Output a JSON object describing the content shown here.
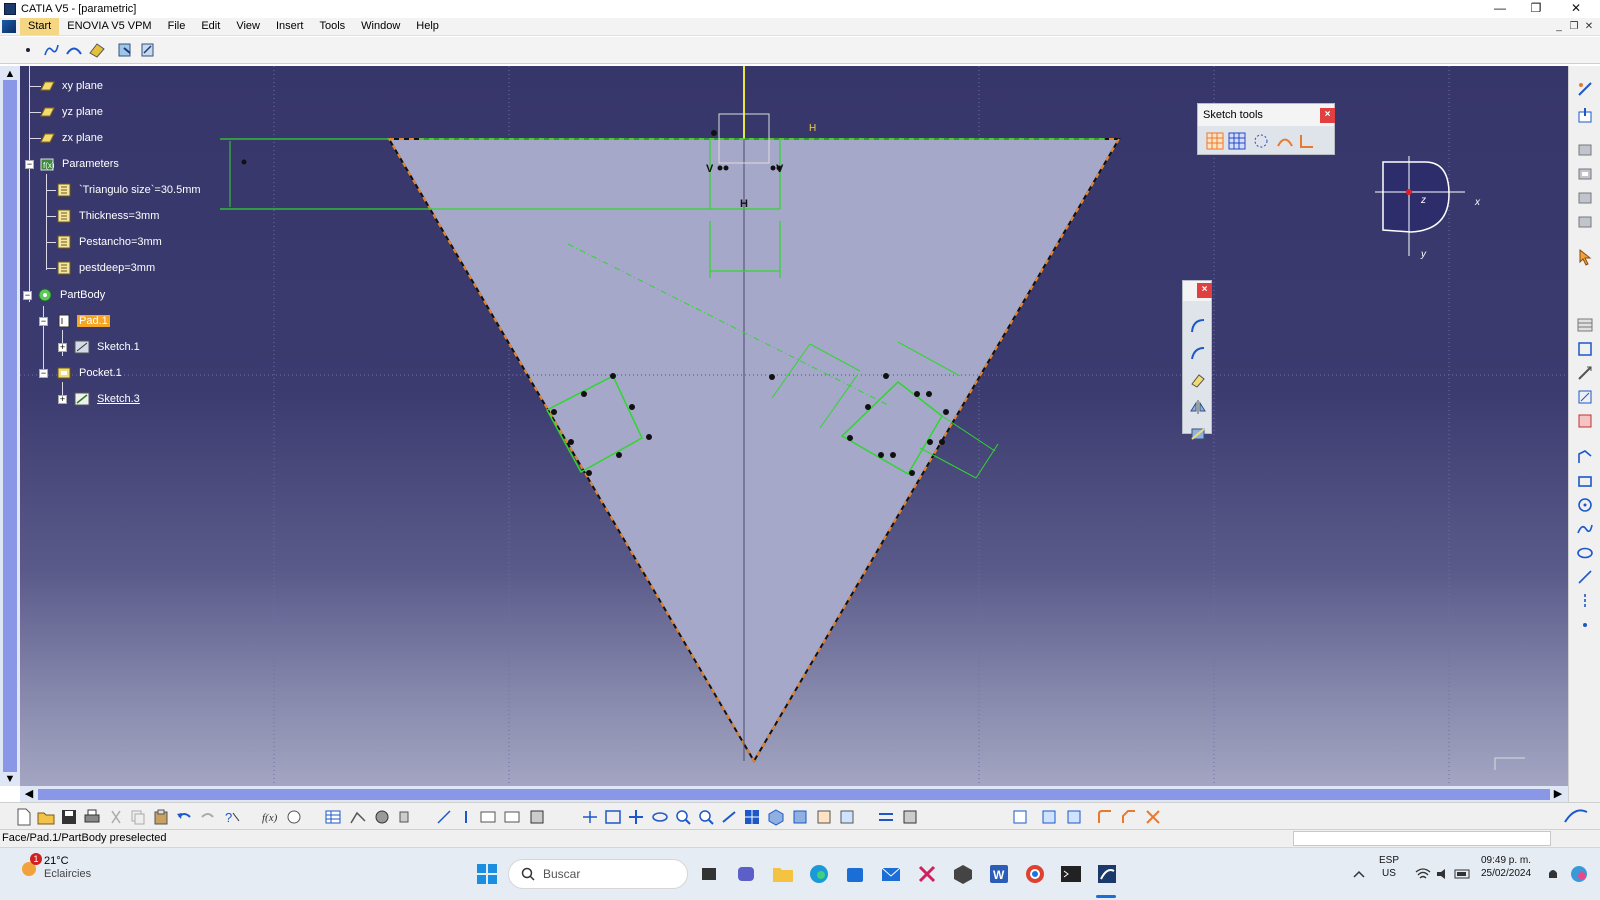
{
  "window": {
    "title": "CATIA V5 - [parametric]",
    "minimize": "—",
    "maximize": "❐",
    "close": "✕"
  },
  "menu": {
    "items": [
      "Start",
      "ENOVIA V5 VPM",
      "File",
      "Edit",
      "View",
      "Insert",
      "Tools",
      "Window",
      "Help"
    ]
  },
  "tree": {
    "planes": [
      "xy plane",
      "yz plane",
      "zx plane"
    ],
    "parameters_label": "Parameters",
    "parameters": [
      "`Triangulo size`=30.5mm",
      "Thickness=3mm",
      "Pestancho=3mm",
      "pestdeep=3mm"
    ],
    "partbody_label": "PartBody",
    "pad_label": "Pad.1",
    "sketch1_label": "Sketch.1",
    "pocket_label": "Pocket.1",
    "sketch3_label": "Sketch.3"
  },
  "sketch_tools": {
    "title": "Sketch tools",
    "close": "×"
  },
  "compass": {
    "x_label": "x",
    "y_label": "y",
    "z_label": "z"
  },
  "sketch_labels": {
    "h_top": "H",
    "h_mid": "H",
    "v_left": "V",
    "v_right": "V"
  },
  "status": {
    "text": "Face/Pad.1/PartBody preselected"
  },
  "taskbar": {
    "temperature": "21°C",
    "weather": "Eclaircies",
    "alert_count": "1",
    "search_placeholder": "Buscar",
    "lang_top": "ESP",
    "lang_bottom": "US",
    "time": "09:49 p. m.",
    "date": "25/02/2024"
  },
  "colors": {
    "viewport_top": "#37366a",
    "viewport_bottom": "#a3a5c2",
    "triangle_fill": "#a6a8c9",
    "sketch_green": "#2fd62f",
    "edge_orange": "#e8842a",
    "selection_orange": "#f7a523"
  }
}
